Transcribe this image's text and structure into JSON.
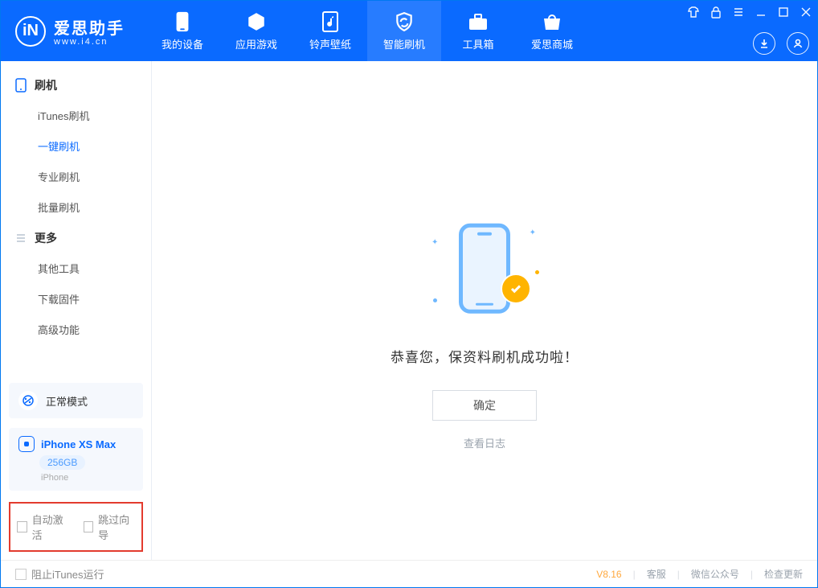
{
  "app": {
    "name_cn": "爱思助手",
    "site": "www.i4.cn",
    "badge_letter": "iN"
  },
  "nav": {
    "items": [
      {
        "label": "我的设备"
      },
      {
        "label": "应用游戏"
      },
      {
        "label": "铃声壁纸"
      },
      {
        "label": "智能刷机"
      },
      {
        "label": "工具箱"
      },
      {
        "label": "爱思商城"
      }
    ]
  },
  "sidebar": {
    "group1": {
      "title": "刷机",
      "items": [
        {
          "label": "iTunes刷机"
        },
        {
          "label": "一键刷机"
        },
        {
          "label": "专业刷机"
        },
        {
          "label": "批量刷机"
        }
      ]
    },
    "group2": {
      "title": "更多",
      "items": [
        {
          "label": "其他工具"
        },
        {
          "label": "下载固件"
        },
        {
          "label": "高级功能"
        }
      ]
    },
    "status": {
      "label": "正常模式"
    },
    "device": {
      "name": "iPhone XS Max",
      "storage": "256GB",
      "type": "iPhone"
    },
    "opts": {
      "auto_activate": "自动激活",
      "skip_guide": "跳过向导"
    }
  },
  "main": {
    "success_msg": "恭喜您，保资料刷机成功啦！",
    "ok_label": "确定",
    "log_link": "查看日志"
  },
  "footer": {
    "block_itunes": "阻止iTunes运行",
    "version": "V8.16",
    "links": {
      "kefu": "客服",
      "wechat": "微信公众号",
      "update": "检查更新"
    }
  }
}
